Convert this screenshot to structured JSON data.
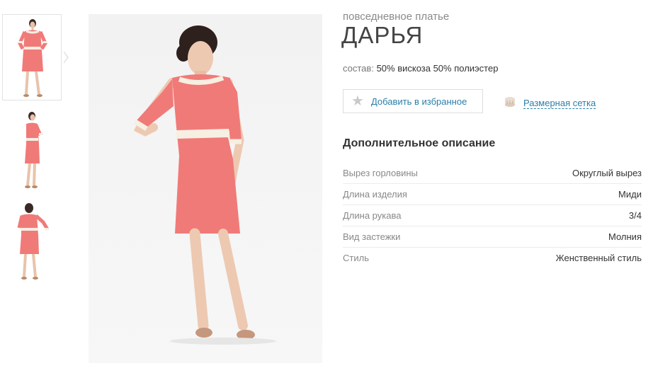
{
  "product": {
    "category": "повседневное платье",
    "name": "ДАРЬЯ",
    "composition_label": "состав:",
    "composition_value": "50% вискоза 50% полиэстер"
  },
  "actions": {
    "favorite_label": "Добавить в избранное",
    "size_chart_label": "Размерная сетка"
  },
  "description": {
    "title": "Дополнительное описание",
    "specs": [
      {
        "key": "Вырез горловины",
        "value": "Округлый вырез"
      },
      {
        "key": "Длина изделия",
        "value": "Миди"
      },
      {
        "key": "Длина рукава",
        "value": "3/4"
      },
      {
        "key": "Вид застежки",
        "value": "Молния"
      },
      {
        "key": "Стиль",
        "value": "Женственный стиль"
      }
    ]
  },
  "colors": {
    "dress": "#f07a78",
    "trim": "#f6efe2",
    "link": "#2a7fa8"
  },
  "gallery": {
    "thumbnails": [
      "front-view",
      "side-view",
      "back-view"
    ],
    "selected_index": 0
  }
}
